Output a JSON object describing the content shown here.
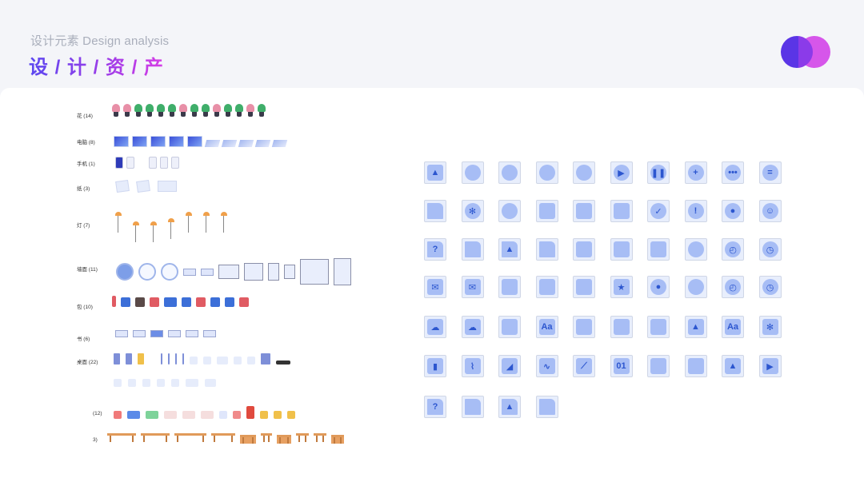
{
  "header": {
    "subtitle": "设计元素 Design analysis",
    "title": "设 / 计 / 资 / 产"
  },
  "colors": {
    "accent1": "#5a35e6",
    "accent2": "#d248e8",
    "icon_fill": "#a7bdf5",
    "icon_stroke": "#2c56cf"
  },
  "rows": [
    {
      "label": "花 (14)"
    },
    {
      "label": "电脑 (8)"
    },
    {
      "label": "手机 (1)"
    },
    {
      "label": "纸 (3)"
    },
    {
      "label": "灯 (7)"
    },
    {
      "label": "墙面 (11)"
    },
    {
      "label": "包 (10)"
    },
    {
      "label": "书 (6)"
    },
    {
      "label": "桌面 (22)"
    },
    {
      "label": "(12)"
    },
    {
      "label": "3)"
    }
  ],
  "icon_rows": [
    [
      "image-icon",
      "avatar-icon",
      "donut-chart-icon",
      "pie-chart-icon",
      "palette-icon",
      "play-icon",
      "pause-icon",
      "plus-icon",
      "more-icon",
      "equals-icon"
    ],
    [
      "file-icon",
      "gear-icon",
      "disc-icon",
      "grid-icon",
      "grid-icon",
      "folder-icon",
      "check-icon",
      "alert-icon",
      "bulb-icon",
      "smile-icon"
    ],
    [
      "question-file-icon",
      "text-file-icon",
      "image-file-icon",
      "text-file-icon",
      "folder-icon",
      "folder-icon",
      "chat-icon",
      "gauge-icon",
      "timer-icon",
      "clock-icon"
    ],
    [
      "mail-icon",
      "open-mail-icon",
      "inbox-icon",
      "frame-icon",
      "text-frame-icon",
      "star-frame-icon",
      "bulb-icon",
      "gauge-icon",
      "timer-icon",
      "clock-icon"
    ],
    [
      "cloud-icon",
      "cloud-icon",
      "book-icon",
      "font-book-icon",
      "notebook-icon",
      "card-icon",
      "browser-icon",
      "browser-image-icon",
      "browser-font-icon",
      "browser-settings-icon"
    ],
    [
      "bar-chart-icon",
      "line-chart-icon",
      "area-chart-icon",
      "wave-chart-icon",
      "trend-chart-icon",
      "calendar-icon",
      "calendar-icon",
      "table-icon",
      "browser-image-icon",
      "browser-play-icon"
    ],
    [
      "question-file-icon",
      "text-file-icon",
      "image-file-icon",
      "text-file-icon"
    ]
  ],
  "icon_glyphs": {
    "plus-icon": "+",
    "more-icon": "•••",
    "equals-icon": "=",
    "check-icon": "✓",
    "alert-icon": "!",
    "play-icon": "▶",
    "pause-icon": "❚❚",
    "question-file-icon": "?",
    "smile-icon": "☺",
    "calendar-01": "01"
  }
}
